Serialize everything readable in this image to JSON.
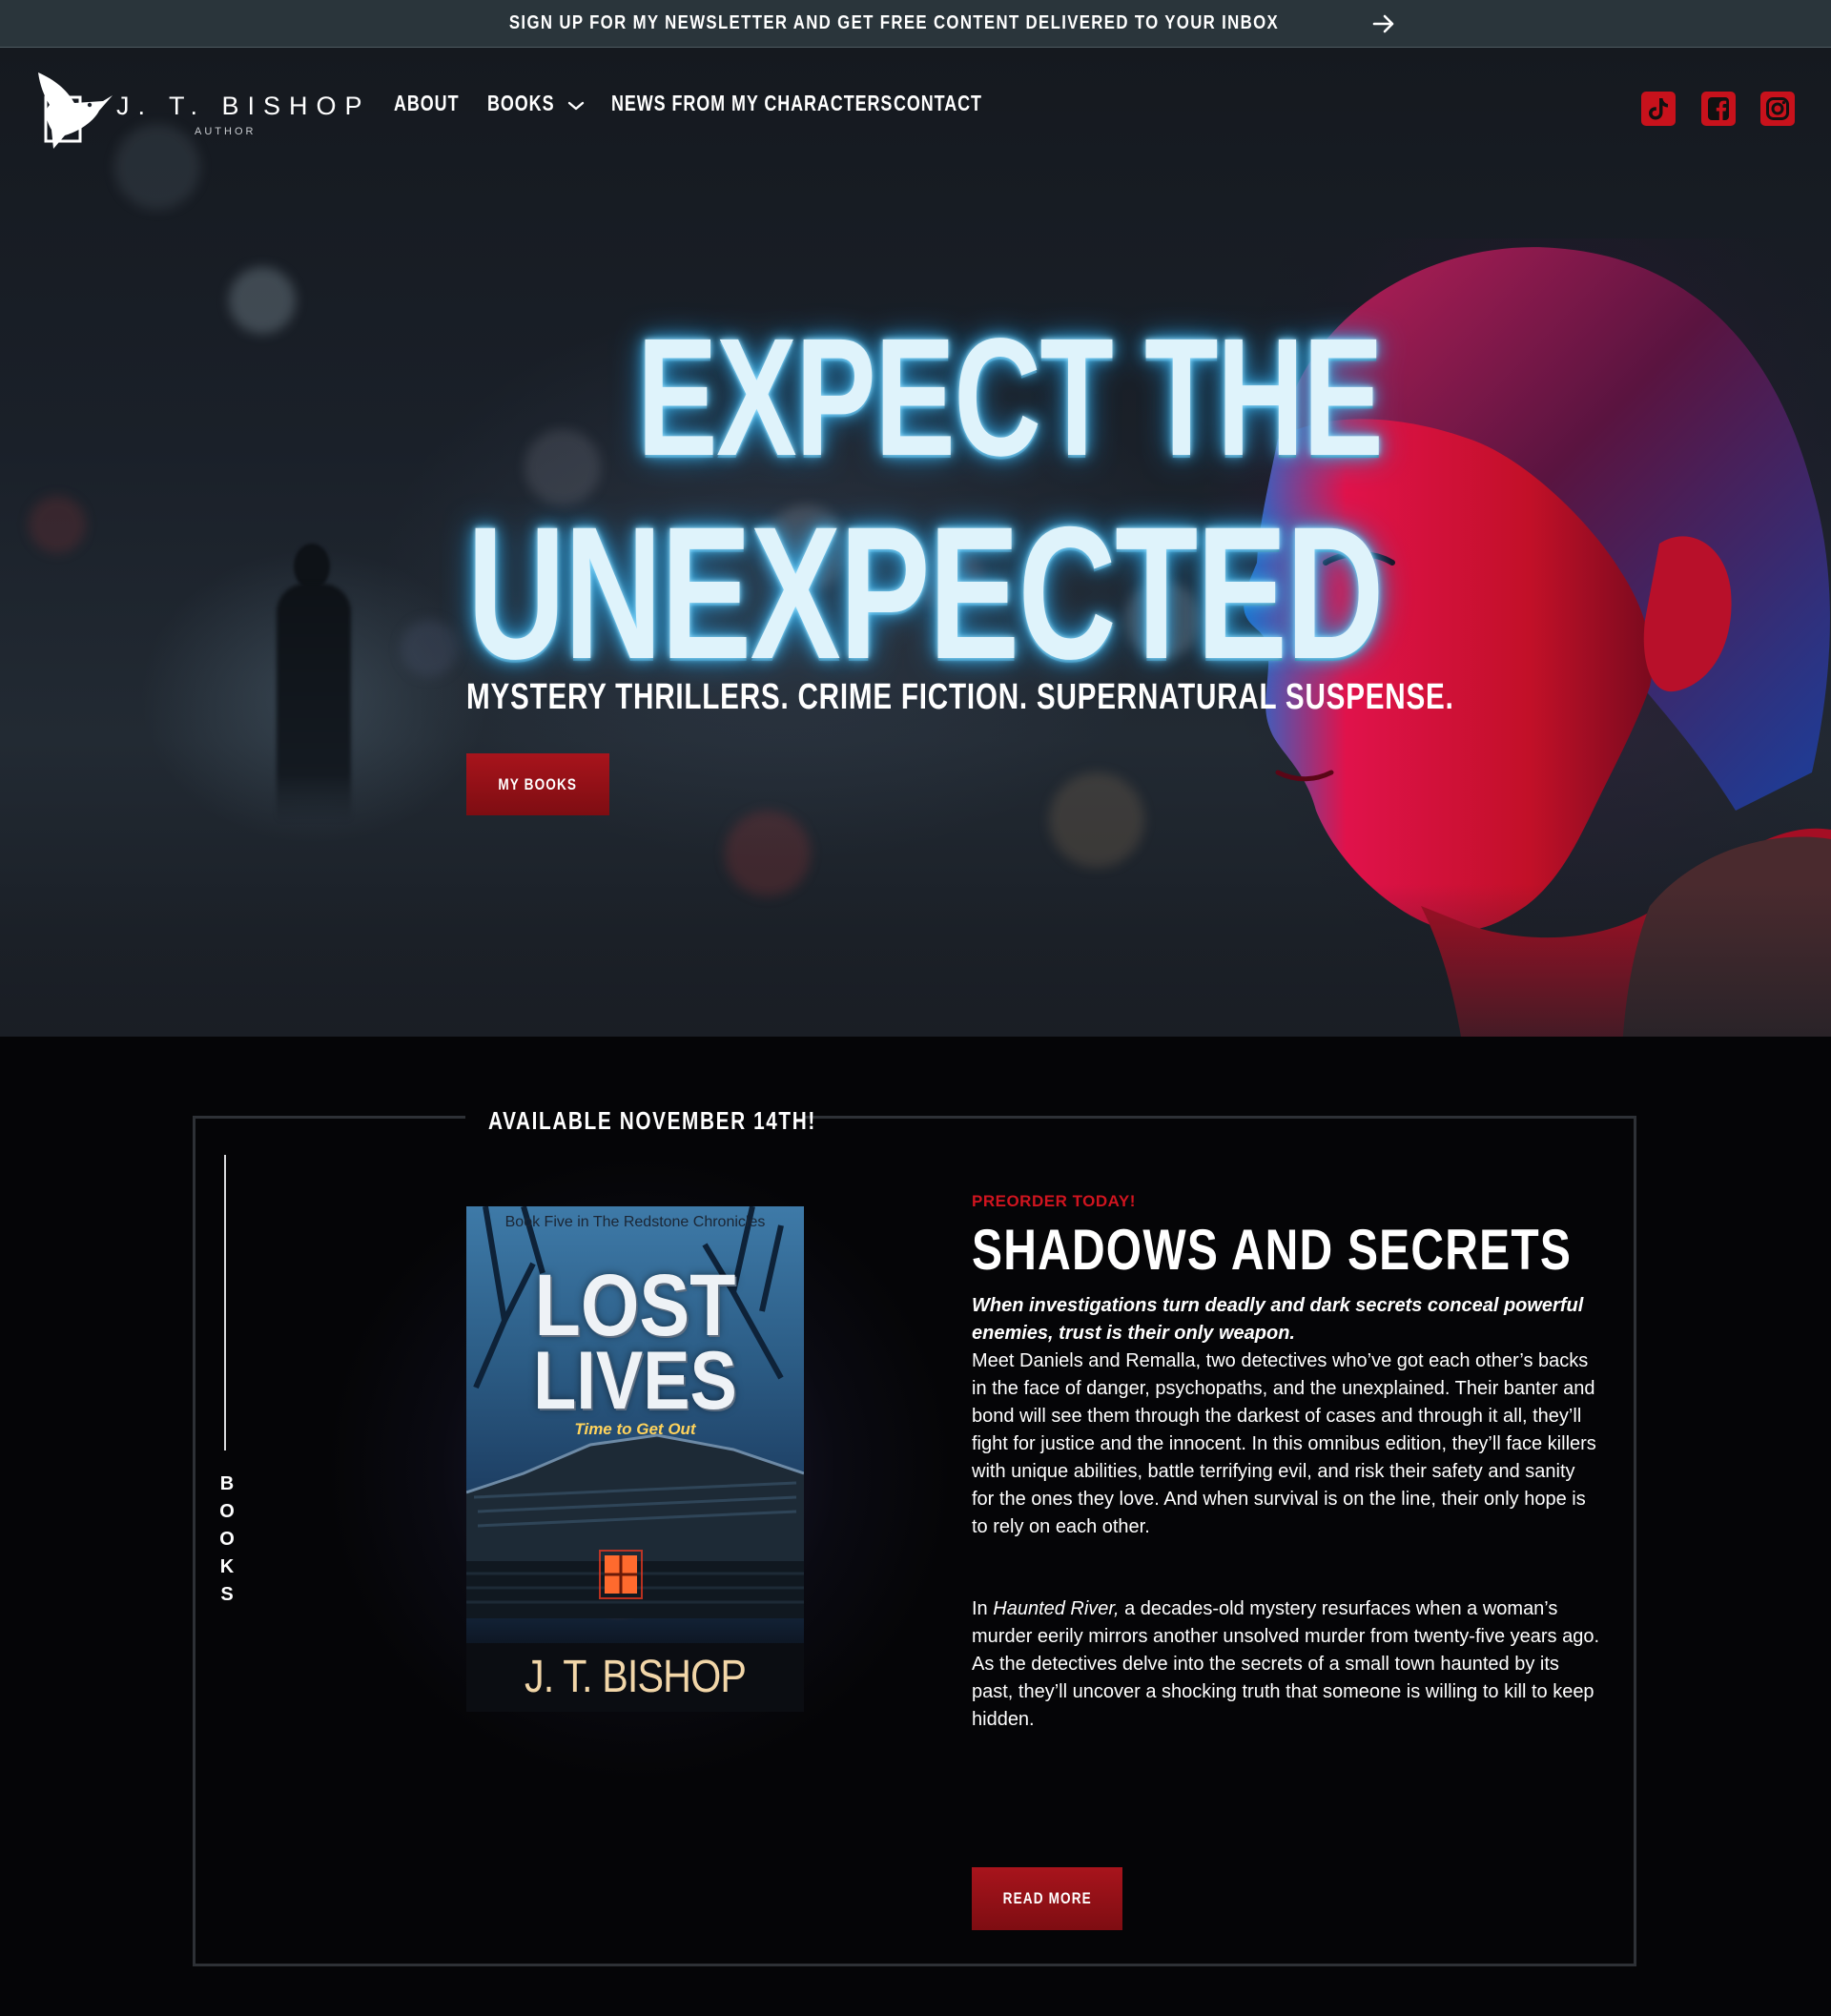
{
  "announcement": {
    "text": "SIGN UP FOR MY NEWSLETTER AND GET FREE CONTENT DELIVERED TO YOUR INBOX",
    "icon": "arrow-right-icon"
  },
  "header": {
    "logo": {
      "name": "J. T. BISHOP",
      "subtitle": "AUTHOR",
      "icon": "hummingbird-logo-icon"
    },
    "nav": [
      {
        "label": "ABOUT"
      },
      {
        "label": "BOOKS",
        "icon": "chevron-down-icon"
      },
      {
        "label": "NEWS FROM MY CHARACTERS"
      },
      {
        "label": "CONTACT"
      }
    ],
    "social": [
      {
        "name": "tiktok",
        "icon": "tiktok-icon"
      },
      {
        "name": "facebook",
        "icon": "facebook-icon"
      },
      {
        "name": "instagram",
        "icon": "instagram-icon"
      }
    ]
  },
  "hero": {
    "headline_line1": "EXPECT THE",
    "headline_line2": "UNEXPECTED",
    "tagline": "MYSTERY THRILLERS. CRIME FICTION. SUPERNATURAL SUSPENSE.",
    "button_label": "MY BOOKS"
  },
  "featured": {
    "frame_label": "AVAILABLE NOVEMBER 14TH!",
    "side_label": "BOOKS",
    "cover": {
      "series": "Book Five in The Redstone Chronicles",
      "title_line1": "LOST",
      "title_line2": "LIVES",
      "subtitle": "Time to Get Out",
      "author": "J. T. BISHOP"
    },
    "eyebrow": "PREORDER TODAY!",
    "title": "SHADOWS AND SECRETS",
    "lead": "When investigations turn deadly and dark secrets conceal powerful enemies, trust is their only weapon.",
    "paragraph1": "Meet Daniels and Remalla, two detectives who’ve got each other’s backs in the face of danger, psychopaths, and the unexplained. Their banter and bond will see them through the darkest of cases and through it all, they’ll fight for justice and the innocent. In this omnibus edition, they’ll face killers with unique abilities, battle terrifying evil, and risk their safety and sanity for the ones they love. And when survival is on the line, their only hope is to rely on each other.",
    "paragraph2_prefix": "In ",
    "paragraph2_italic": "Haunted River,",
    "paragraph2_rest": " a decades-old mystery resurfaces when a woman’s murder eerily mirrors another unsolved murder from twenty-five years ago. As the detectives delve into the secrets of a small town haunted by its past, they’ll uncover a shocking truth that someone is willing to kill to keep hidden.",
    "button_label": "READ MORE"
  },
  "colors": {
    "accent_red": "#c8121c",
    "topbar": "#2a353b",
    "neon": "#9fe2ff",
    "background": "#050507"
  }
}
